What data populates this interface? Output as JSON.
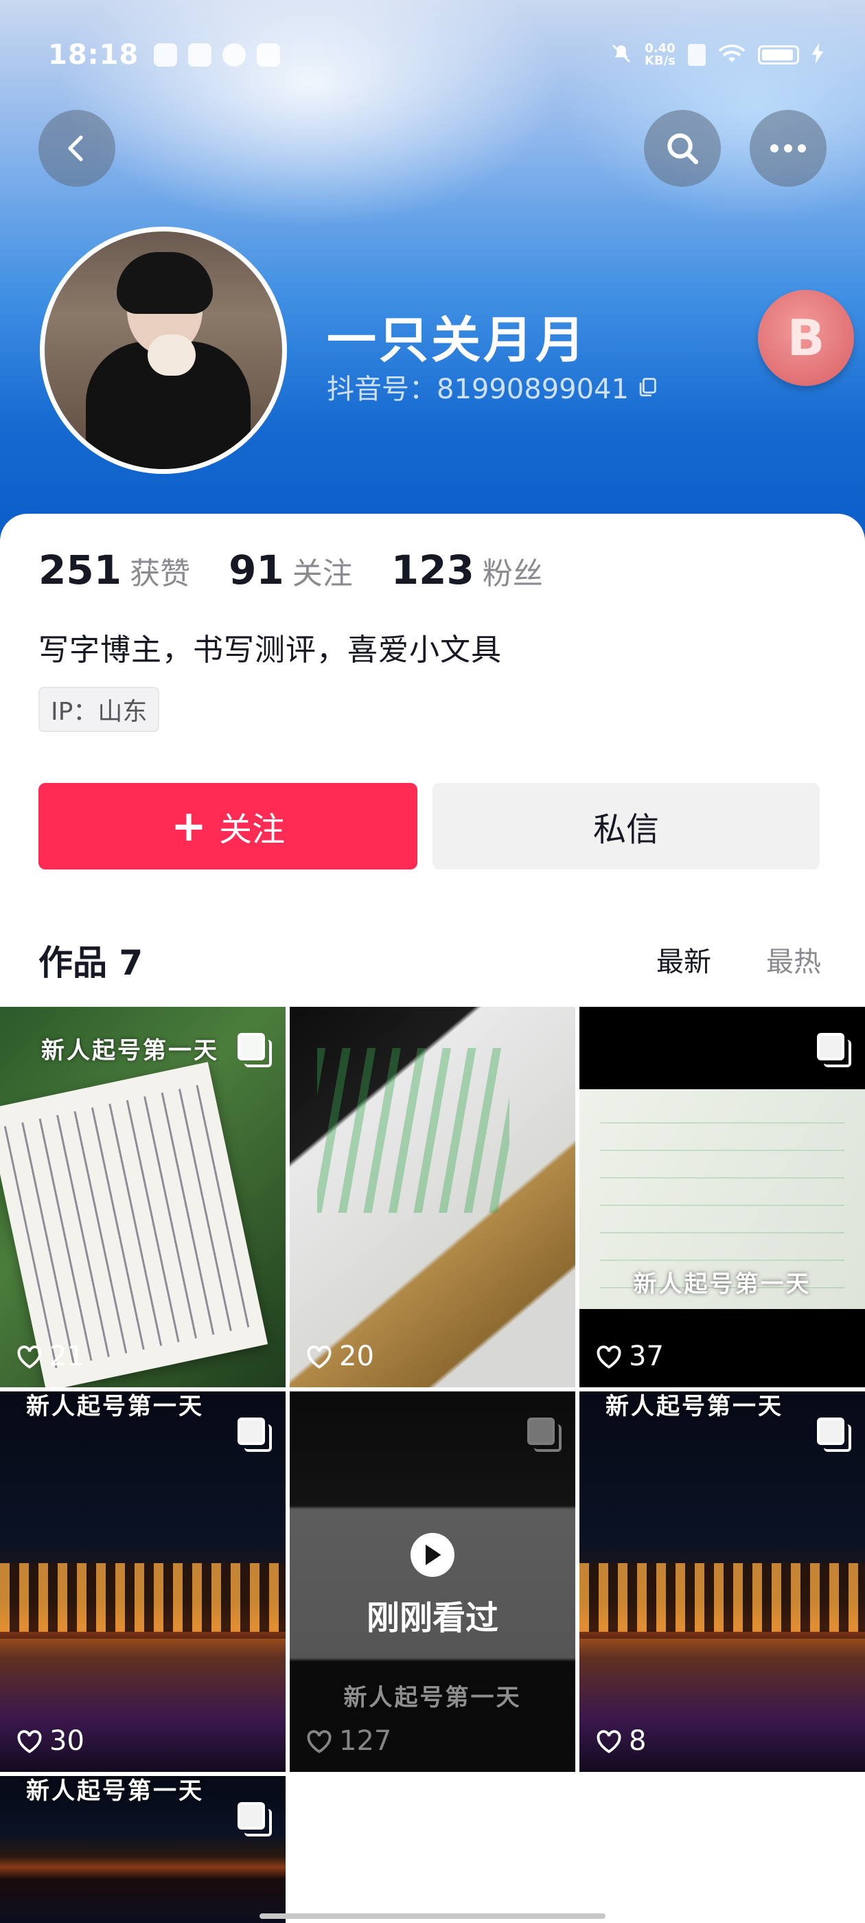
{
  "status_bar": {
    "time": "18:18",
    "net_speed_value": "0.40",
    "net_speed_unit": "KB/s"
  },
  "profile": {
    "name": "一只关月月",
    "douyin_id": "抖音号：81990899041",
    "badge_letter": "B",
    "bio": "写字博主，书写测评，喜爱小文具",
    "ip": "IP：山东"
  },
  "stats": [
    {
      "value": "251",
      "label": "获赞"
    },
    {
      "value": "91",
      "label": "关注"
    },
    {
      "value": "123",
      "label": "粉丝"
    }
  ],
  "actions": {
    "follow_label": "关注",
    "message_label": "私信"
  },
  "works": {
    "title": "作品 7",
    "sort_new": "最新",
    "sort_hot": "最热",
    "items": [
      {
        "caption": "新人起号第一天",
        "likes": "21"
      },
      {
        "caption": "",
        "likes": "20"
      },
      {
        "caption": "新人起号第一天",
        "likes": "37"
      },
      {
        "caption": "新人起号第一天",
        "likes": "30"
      },
      {
        "caption": "新人起号第一天",
        "likes": "127",
        "overlay": "刚刚看过"
      },
      {
        "caption": "新人起号第一天",
        "likes": "8"
      },
      {
        "caption": "新人起号第一天",
        "likes": ""
      }
    ]
  },
  "colors": {
    "accent": "#fe2c55",
    "text_primary": "#161823",
    "text_secondary": "#8a8b91"
  }
}
